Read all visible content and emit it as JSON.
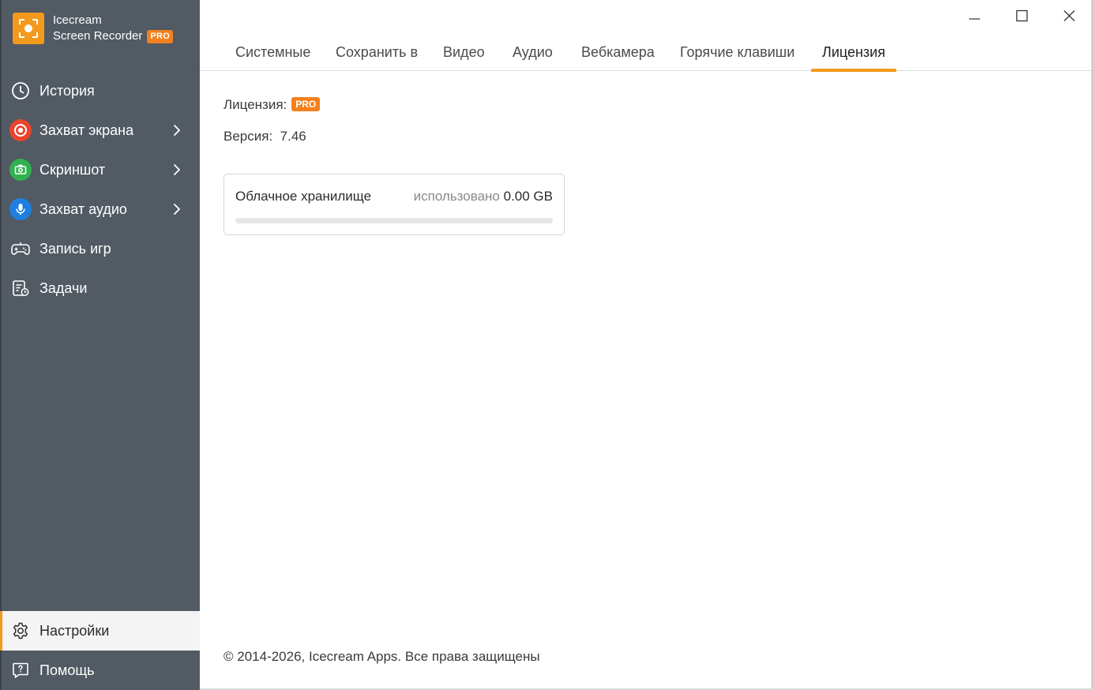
{
  "app": {
    "name_line1": "Icecream",
    "name_line2": "Screen Recorder",
    "badge": "PRO",
    "accent_color": "#f39a1c",
    "sidebar_color": "#525a63"
  },
  "window_controls": {
    "minimize_icon": "minimize-icon",
    "maximize_icon": "maximize-icon",
    "close_icon": "close-icon"
  },
  "sidebar": {
    "items": [
      {
        "label": "История",
        "icon": "clock-icon"
      },
      {
        "label": "Захват экрана",
        "icon": "record-icon",
        "color": "#e8452c",
        "has_submenu": true
      },
      {
        "label": "Скриншот",
        "icon": "camera-icon",
        "color": "#2fb24f",
        "has_submenu": true
      },
      {
        "label": "Захват аудио",
        "icon": "microphone-icon",
        "color": "#1e7fe0",
        "has_submenu": true
      },
      {
        "label": "Запись игр",
        "icon": "gamepad-icon"
      },
      {
        "label": "Задачи",
        "icon": "tasks-icon"
      }
    ],
    "bottom": [
      {
        "label": "Настройки",
        "icon": "gear-icon",
        "active": true
      },
      {
        "label": "Помощь",
        "icon": "help-icon"
      }
    ]
  },
  "tabs": [
    {
      "label": "Системные"
    },
    {
      "label": "Сохранить в"
    },
    {
      "label": "Видео"
    },
    {
      "label": "Аудио"
    },
    {
      "label": "Вебкамера"
    },
    {
      "label": "Горячие клавиши"
    },
    {
      "label": "Лицензия",
      "active": true
    }
  ],
  "license": {
    "label": "Лицензия:",
    "badge": "PRO",
    "version_label": "Версия:",
    "version_value": "7.46"
  },
  "cloud": {
    "title": "Облачное хранилище",
    "used_label": "использовано",
    "used_value": "0.00 GB",
    "progress_percent": 0
  },
  "footer": {
    "copyright": "© 2014-2026, Icecream Apps. Все права защищены"
  }
}
